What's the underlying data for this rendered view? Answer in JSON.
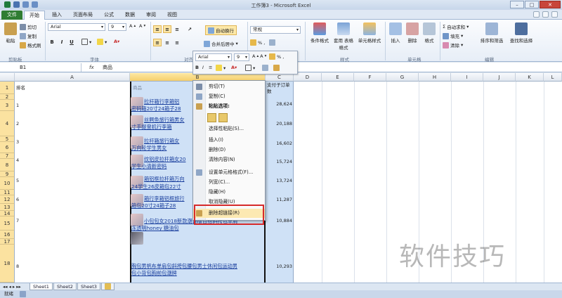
{
  "window": {
    "title": "工作簿3 - Microsoft Excel"
  },
  "tabs": [
    "文件",
    "开始",
    "插入",
    "页面布局",
    "公式",
    "数据",
    "审阅",
    "视图"
  ],
  "ribbon": {
    "clipboard": {
      "paste": "粘贴",
      "cut": "剪切",
      "copy": "复制",
      "format_painter": "格式刷",
      "group": "剪贴板"
    },
    "font": {
      "name": "Arial",
      "size": "9",
      "group": "字体",
      "bold": "B",
      "italic": "I",
      "underline": "U"
    },
    "alignment": {
      "wrap": "自动换行",
      "merge": "合并后居中",
      "group": "对齐方式"
    },
    "number": {
      "format": "常规",
      "group": "数字"
    },
    "styles": {
      "conditional": "条件格式",
      "table": "套用\n表格格式",
      "cell": "单元格样式",
      "group": "样式"
    },
    "cells": {
      "insert": "插入",
      "delete": "删除",
      "format": "格式",
      "group": "单元格"
    },
    "editing": {
      "autosum": "自动求和",
      "fill": "填充",
      "clear": "清除",
      "sort": "排序和筛选",
      "find": "查找和选择",
      "group": "编辑"
    }
  },
  "formula_bar": {
    "name_box": "B1",
    "fx": "fx",
    "content": "商品"
  },
  "mini_toolbar": {
    "font": "Arial",
    "size": "9"
  },
  "grid": {
    "columns": [
      "A",
      "B",
      "C",
      "D",
      "E",
      "F",
      "G",
      "H",
      "I",
      "J",
      "K",
      "L"
    ],
    "rows": [
      "1",
      "2",
      "3",
      "4",
      "5",
      "6",
      "7",
      "8",
      "9",
      "10",
      "11",
      "12",
      "13",
      "14",
      "15",
      "16",
      "17",
      "18"
    ],
    "a1": "排名",
    "b1": "商品",
    "d1": "支付子订单数",
    "ranks": [
      "1",
      "2",
      "3",
      "4",
      "5",
      "6",
      "7",
      "8"
    ],
    "products": [
      [
        "拉杆箱行李箱铝",
        "密码箱20寸24箱子28"
      ],
      [
        "丝鳄鱼旅行箱男女",
        "寸手提登机行李箱"
      ],
      [
        "拉杆箱旅行箱女",
        "万向轮学生男女"
      ],
      [
        "纹铝皮拉杆箱女20",
        "学生小清新密码"
      ],
      [
        "箱铝框拉杆箱万向",
        "24学生26皮箱包22寸"
      ],
      [
        "箱行李箱铝框旅行",
        "箱包20寸24箱子28"
      ],
      [
        "小包包女2018新款潮韩版百搭斜挎包单肩",
        "冻透明honey 糖油包"
      ],
      [
        "胸包男帆布单肩包斜挎包腰包男士休闲包运动男",
        "包小背包胸前包潮牌"
      ]
    ],
    "orders": [
      "28,624",
      "20,188",
      "16,602",
      "15,724",
      "13,724",
      "11,287",
      "10,884",
      "10,293"
    ]
  },
  "context_menu": {
    "items": [
      "剪切(T)",
      "复制(C)",
      "粘贴选项:",
      "",
      "选择性粘贴(S)...",
      "插入(I)",
      "删除(D)",
      "清除内容(N)",
      "设置单元格格式(F)...",
      "列宽(C)...",
      "隐藏(H)",
      "取消隐藏(U)",
      "删除超链接(R)"
    ]
  },
  "sheets": [
    "Sheet1",
    "Sheet2",
    "Sheet3"
  ],
  "status": {
    "ready": "就绪"
  },
  "watermark": "软件技巧",
  "colors": {
    "file_tab": "#2f7d32",
    "selection": "#cfe1f6",
    "highlight_box": "#d62a2a",
    "link": "#1a3f9e"
  }
}
